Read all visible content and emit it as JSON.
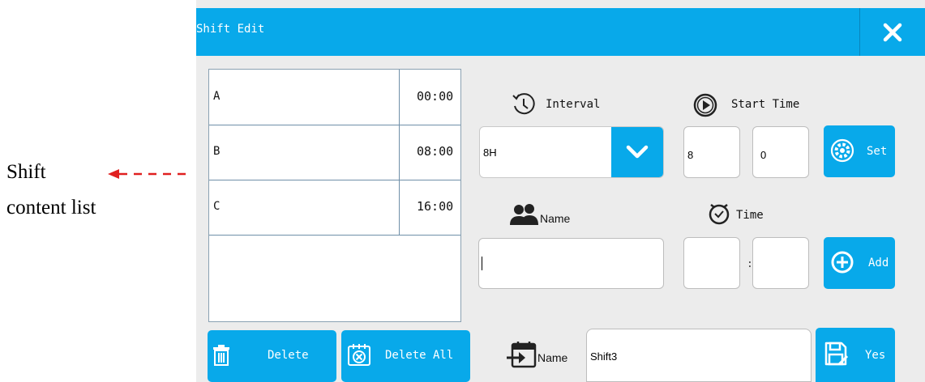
{
  "annotation": {
    "line1": "Shift",
    "line2": "content list"
  },
  "window": {
    "title": "Shift Edit"
  },
  "shifts": [
    {
      "name": "A",
      "time": "00:00"
    },
    {
      "name": "B",
      "time": "08:00"
    },
    {
      "name": "C",
      "time": "16:00"
    }
  ],
  "buttons": {
    "delete": "Delete",
    "delete_all": "Delete All",
    "set": "Set",
    "add": "Add",
    "yes": "Yes"
  },
  "interval": {
    "label": "Interval",
    "value": "8H"
  },
  "start_time": {
    "label": "Start Time",
    "hour": "8",
    "minute": "0"
  },
  "name_section": {
    "label": "Name",
    "value": ""
  },
  "time_section": {
    "label": "Time",
    "hour": "",
    "minute": ""
  },
  "shift_name": {
    "label": "Name",
    "value": "Shift3"
  },
  "separator": ":",
  "colors": {
    "accent": "#08a9ea",
    "arrow": "#e02020",
    "background": "#ececec"
  },
  "icons": {
    "close": "close-icon",
    "interval": "clock-rotate-icon",
    "start_time": "play-circle-icon",
    "set": "gear-icon",
    "name": "users-icon",
    "time": "alarm-clock-icon",
    "add": "plus-circle-icon",
    "delete": "trash-icon",
    "delete_all": "calendar-x-icon",
    "shift_name": "calendar-enter-icon",
    "yes": "save-icon",
    "dropdown": "chevron-down-icon"
  }
}
